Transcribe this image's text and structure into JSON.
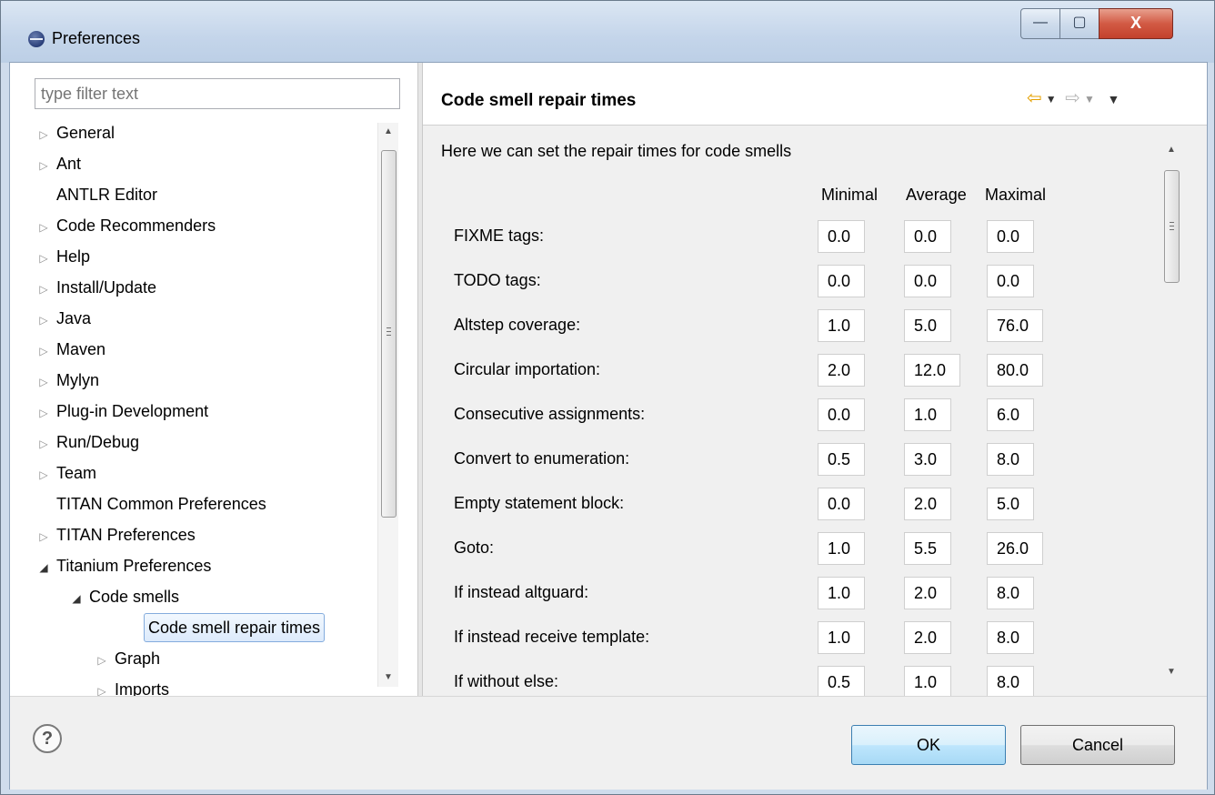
{
  "window": {
    "title": "Preferences",
    "minimize": "—",
    "maximize": "▢",
    "close": "X"
  },
  "filter": {
    "placeholder": "type filter text"
  },
  "tree": [
    {
      "label": "General",
      "arrow": "▷"
    },
    {
      "label": "Ant",
      "arrow": "▷"
    },
    {
      "label": "ANTLR Editor",
      "arrow": ""
    },
    {
      "label": "Code Recommenders",
      "arrow": "▷"
    },
    {
      "label": "Help",
      "arrow": "▷"
    },
    {
      "label": "Install/Update",
      "arrow": "▷"
    },
    {
      "label": "Java",
      "arrow": "▷"
    },
    {
      "label": "Maven",
      "arrow": "▷"
    },
    {
      "label": "Mylyn",
      "arrow": "▷"
    },
    {
      "label": "Plug-in Development",
      "arrow": "▷"
    },
    {
      "label": "Run/Debug",
      "arrow": "▷"
    },
    {
      "label": "Team",
      "arrow": "▷"
    },
    {
      "label": "TITAN Common Preferences",
      "arrow": ""
    },
    {
      "label": "TITAN Preferences",
      "arrow": "▷"
    },
    {
      "label": "Titanium Preferences",
      "arrow": "◢"
    },
    {
      "label": "Code smells",
      "arrow": "◢"
    },
    {
      "label": "Code smell repair times",
      "arrow": ""
    },
    {
      "label": "Graph",
      "arrow": "▷"
    },
    {
      "label": "Imports",
      "arrow": "▷"
    }
  ],
  "page": {
    "title": "Code smell repair times",
    "intro": "Here we can set the repair times for code smells",
    "col_minimal": "Minimal",
    "col_average": "Average",
    "col_maximal": "Maximal",
    "rows": [
      {
        "label": "FIXME tags:",
        "min": "0.0",
        "avg": "0.0",
        "max": "0.0"
      },
      {
        "label": "TODO tags:",
        "min": "0.0",
        "avg": "0.0",
        "max": "0.0"
      },
      {
        "label": "Altstep coverage:",
        "min": "1.0",
        "avg": "5.0",
        "max": "76.0"
      },
      {
        "label": "Circular importation:",
        "min": "2.0",
        "avg": "12.0",
        "max": "80.0"
      },
      {
        "label": "Consecutive assignments:",
        "min": "0.0",
        "avg": "1.0",
        "max": "6.0"
      },
      {
        "label": "Convert to enumeration:",
        "min": "0.5",
        "avg": "3.0",
        "max": "8.0"
      },
      {
        "label": "Empty statement block:",
        "min": "0.0",
        "avg": "2.0",
        "max": "5.0"
      },
      {
        "label": "Goto:",
        "min": "1.0",
        "avg": "5.5",
        "max": "26.0"
      },
      {
        "label": "If instead altguard:",
        "min": "1.0",
        "avg": "2.0",
        "max": "8.0"
      },
      {
        "label": "If instead receive template:",
        "min": "1.0",
        "avg": "2.0",
        "max": "8.0"
      },
      {
        "label": "If without else:",
        "min": "0.5",
        "avg": "1.0",
        "max": "8.0"
      }
    ]
  },
  "buttons": {
    "help": "?",
    "ok": "OK",
    "cancel": "Cancel"
  },
  "icons": {
    "title": "eclipse-icon",
    "back": "⇦",
    "forward": "⇨",
    "dropdown": "▼"
  }
}
